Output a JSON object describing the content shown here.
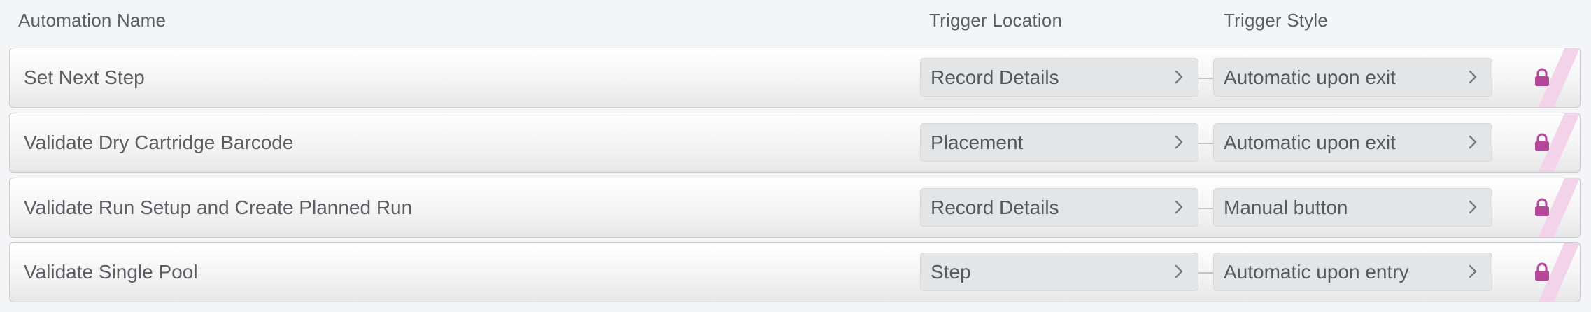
{
  "columns": {
    "name": "Automation Name",
    "location": "Trigger Location",
    "style": "Trigger Style"
  },
  "rows": [
    {
      "name": "Set Next Step",
      "location": "Record Details",
      "style": "Automatic upon exit",
      "locked": true
    },
    {
      "name": "Validate Dry Cartridge Barcode",
      "location": "Placement",
      "style": "Automatic upon exit",
      "locked": true
    },
    {
      "name": "Validate Run Setup and Create Planned Run",
      "location": "Record Details",
      "style": "Manual button",
      "locked": true
    },
    {
      "name": "Validate Single Pool",
      "location": "Step",
      "style": "Automatic upon entry",
      "locked": true
    }
  ],
  "icons": {
    "chevron": "chevron-right-icon",
    "lock": "lock-icon"
  },
  "colors": {
    "lock": "#b4479a",
    "lock_stripe": "#f3d3ea"
  }
}
